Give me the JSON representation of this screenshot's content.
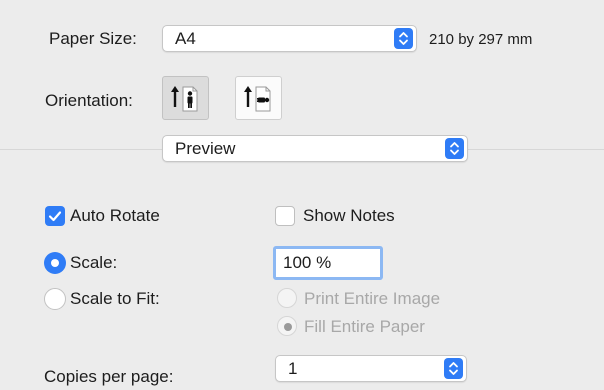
{
  "paper": {
    "label": "Paper Size:",
    "value": "A4",
    "dimensions": "210 by 297 mm"
  },
  "orientation": {
    "label": "Orientation:",
    "options": [
      {
        "name": "portrait",
        "selected": true,
        "icon": "portrait-person-icon"
      },
      {
        "name": "landscape",
        "selected": false,
        "icon": "landscape-person-icon"
      }
    ]
  },
  "app_menu": {
    "value": "Preview"
  },
  "options": {
    "auto_rotate": {
      "label": "Auto Rotate",
      "checked": true
    },
    "show_notes": {
      "label": "Show Notes",
      "checked": false
    },
    "scale": {
      "label": "Scale:",
      "selected": true,
      "value": "100 %"
    },
    "scale_to_fit": {
      "label": "Scale to Fit:",
      "selected": false
    },
    "print_entire_image": {
      "label": "Print Entire Image",
      "selected": false,
      "enabled": false
    },
    "fill_entire_paper": {
      "label": "Fill Entire Paper",
      "selected": true,
      "enabled": false
    }
  },
  "copies": {
    "label": "Copies per page:",
    "value": "1"
  },
  "colors": {
    "accent": "#2f7cf6",
    "focus_ring": "#8cb8f3",
    "background": "#ececec"
  }
}
